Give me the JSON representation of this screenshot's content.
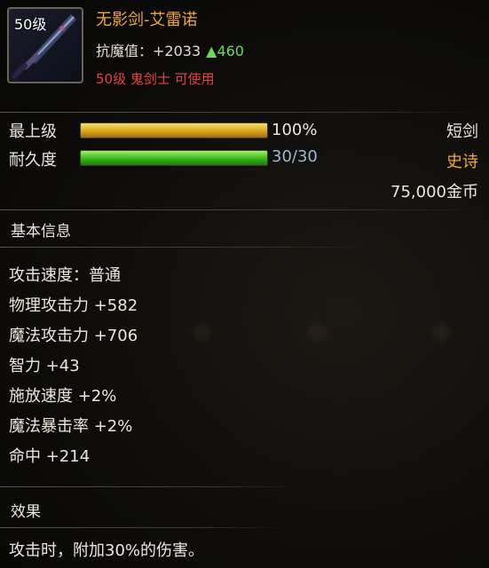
{
  "item": {
    "level_badge": "50级",
    "name": "无影剑-艾雷诺",
    "resist_label": "抗魔值：+2033",
    "resist_bonus": "▲460",
    "requirement": "50级 鬼剑士 可使用"
  },
  "bars": {
    "grade": {
      "label": "最上级",
      "value_text": "100%",
      "fill": 1.0
    },
    "durability": {
      "label": "耐久度",
      "value_text": "30/30",
      "fill": 1.0
    }
  },
  "side": {
    "weapon_type": "短剑",
    "rarity": "史诗",
    "price": "75,000金币"
  },
  "basic_info": {
    "title": "基本信息",
    "stats": [
      "攻击速度：普通",
      "物理攻击力 +582",
      "魔法攻击力 +706",
      "智力 +43",
      "施放速度 +2%",
      "魔法暴击率 +2%",
      "命中 +214"
    ]
  },
  "effect": {
    "title": "效果",
    "text": "攻击时，附加30%的伤害。"
  },
  "colors": {
    "name": "#f0a63a",
    "bonus": "#6ed85a",
    "requirement": "#e8433e",
    "rarity": "#f0a63a",
    "durability_text": "#9bb6d6"
  }
}
